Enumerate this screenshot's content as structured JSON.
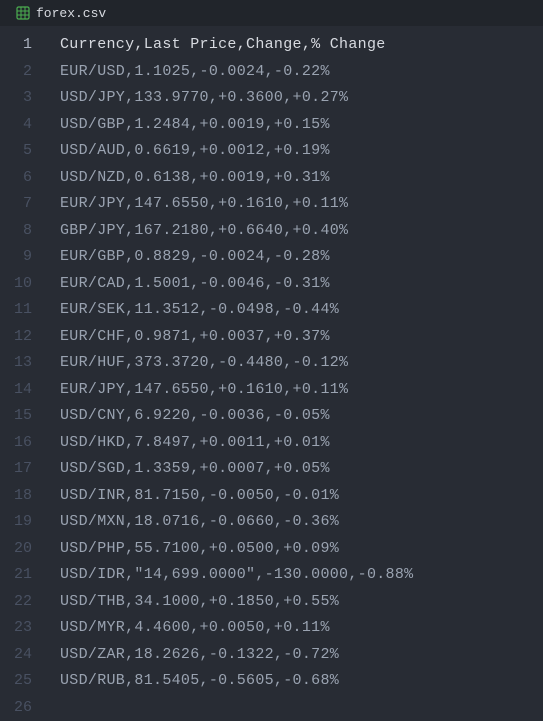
{
  "tab": {
    "filename": "forex.csv"
  },
  "editor": {
    "active_line": 1,
    "lines": [
      "Currency,Last Price,Change,% Change",
      "EUR/USD,1.1025,-0.0024,-0.22%",
      "USD/JPY,133.9770,+0.3600,+0.27%",
      "USD/GBP,1.2484,+0.0019,+0.15%",
      "USD/AUD,0.6619,+0.0012,+0.19%",
      "USD/NZD,0.6138,+0.0019,+0.31%",
      "EUR/JPY,147.6550,+0.1610,+0.11%",
      "GBP/JPY,167.2180,+0.6640,+0.40%",
      "EUR/GBP,0.8829,-0.0024,-0.28%",
      "EUR/CAD,1.5001,-0.0046,-0.31%",
      "EUR/SEK,11.3512,-0.0498,-0.44%",
      "EUR/CHF,0.9871,+0.0037,+0.37%",
      "EUR/HUF,373.3720,-0.4480,-0.12%",
      "EUR/JPY,147.6550,+0.1610,+0.11%",
      "USD/CNY,6.9220,-0.0036,-0.05%",
      "USD/HKD,7.8497,+0.0011,+0.01%",
      "USD/SGD,1.3359,+0.0007,+0.05%",
      "USD/INR,81.7150,-0.0050,-0.01%",
      "USD/MXN,18.0716,-0.0660,-0.36%",
      "USD/PHP,55.7100,+0.0500,+0.09%",
      "USD/IDR,\"14,699.0000\",-130.0000,-0.88%",
      "USD/THB,34.1000,+0.1850,+0.55%",
      "USD/MYR,4.4600,+0.0050,+0.11%",
      "USD/ZAR,18.2626,-0.1322,-0.72%",
      "USD/RUB,81.5405,-0.5605,-0.68%",
      ""
    ]
  }
}
